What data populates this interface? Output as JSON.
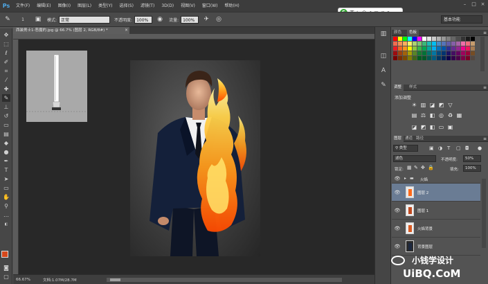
{
  "app": {
    "logo": "Ps"
  },
  "menu": [
    "文件(F)",
    "编辑(E)",
    "图像(I)",
    "图层(L)",
    "类型(Y)",
    "选择(S)",
    "滤镜(T)",
    "3D(D)",
    "视图(V)",
    "窗口(W)",
    "帮助(H)"
  ],
  "window_controls": [
    "–",
    "□",
    "×"
  ],
  "options": {
    "brush_size": "1",
    "mode_label": "模式:",
    "mode_value": "正常",
    "opacity_label": "不透明度:",
    "opacity_value": "100%",
    "flow_label": "流量:",
    "flow_value": "100%",
    "workspace": "基本功能"
  },
  "ime_toolbar": {
    "logo": "S",
    "lang": "英"
  },
  "document": {
    "tab_title": "西装男士1-恶魔的.jpg @ 66.7% (图层 2, RGB/8#) *",
    "close": "×",
    "zoom": "66.67%",
    "doc_size": "文档:1.07M/28.7M"
  },
  "swatch_colors": [
    "#ff0000",
    "#ffff00",
    "#00ff00",
    "#00ffff",
    "#0000ff",
    "#ff00ff",
    "#ffffff",
    "#e6e6e6",
    "#cccccc",
    "#b3b3b3",
    "#999999",
    "#808080",
    "#666666",
    "#4d4d4d",
    "#333333",
    "#1a1a1a",
    "#000000",
    "#f26c4f",
    "#f68e55",
    "#fbaf5c",
    "#fff467",
    "#acd372",
    "#7cc576",
    "#3bb878",
    "#1abbb4",
    "#00bff3",
    "#438cca",
    "#5574b9",
    "#605ca8",
    "#855fa8",
    "#a763a8",
    "#f06ea9",
    "#f26d7d",
    "#c69c6d",
    "#ed1c24",
    "#f26522",
    "#f7941d",
    "#fff200",
    "#8dc63f",
    "#39b54a",
    "#00a651",
    "#00a99d",
    "#00aeef",
    "#0072bc",
    "#0054a6",
    "#2e3192",
    "#662d91",
    "#92278f",
    "#ec008c",
    "#ed145b",
    "#a67c52",
    "#9e0b0f",
    "#a0410d",
    "#a3620a",
    "#aba000",
    "#598527",
    "#197b30",
    "#007236",
    "#00746b",
    "#0076a3",
    "#004b80",
    "#003471",
    "#1b1464",
    "#440e62",
    "#630460",
    "#9e005d",
    "#9e0039",
    "#754c24",
    "#790000",
    "#7b2e00",
    "#7d4900",
    "#827b00",
    "#406618",
    "#005e20",
    "#005826",
    "#005952",
    "#005b7f",
    "#003663",
    "#002157",
    "#0d004c",
    "#32004b",
    "#4b0049",
    "#7b0046",
    "#7a0026",
    "#534741"
  ],
  "panels": {
    "color_tabs": [
      "颜色",
      "色板"
    ],
    "adjust_tabs": [
      "调整",
      "样式"
    ],
    "adjust_title": "添加调整",
    "layer_tabs": [
      "图层",
      "通道",
      "路径"
    ],
    "filter_kind": "类型",
    "blend_mode": "滤色",
    "opacity_label": "不透明度:",
    "opacity_value": "50%",
    "lock_label": "锁定:",
    "fill_label": "填充:",
    "fill_value": "100%",
    "layers": [
      {
        "name": "火焰",
        "type": "group"
      },
      {
        "name": "图层 2",
        "selected": true
      },
      {
        "name": "图层 1"
      },
      {
        "name": "火焰背景"
      },
      {
        "name": "背景图层"
      }
    ]
  },
  "watermark": {
    "text": "小钱学设计",
    "url": "UiBQ.CoM"
  }
}
